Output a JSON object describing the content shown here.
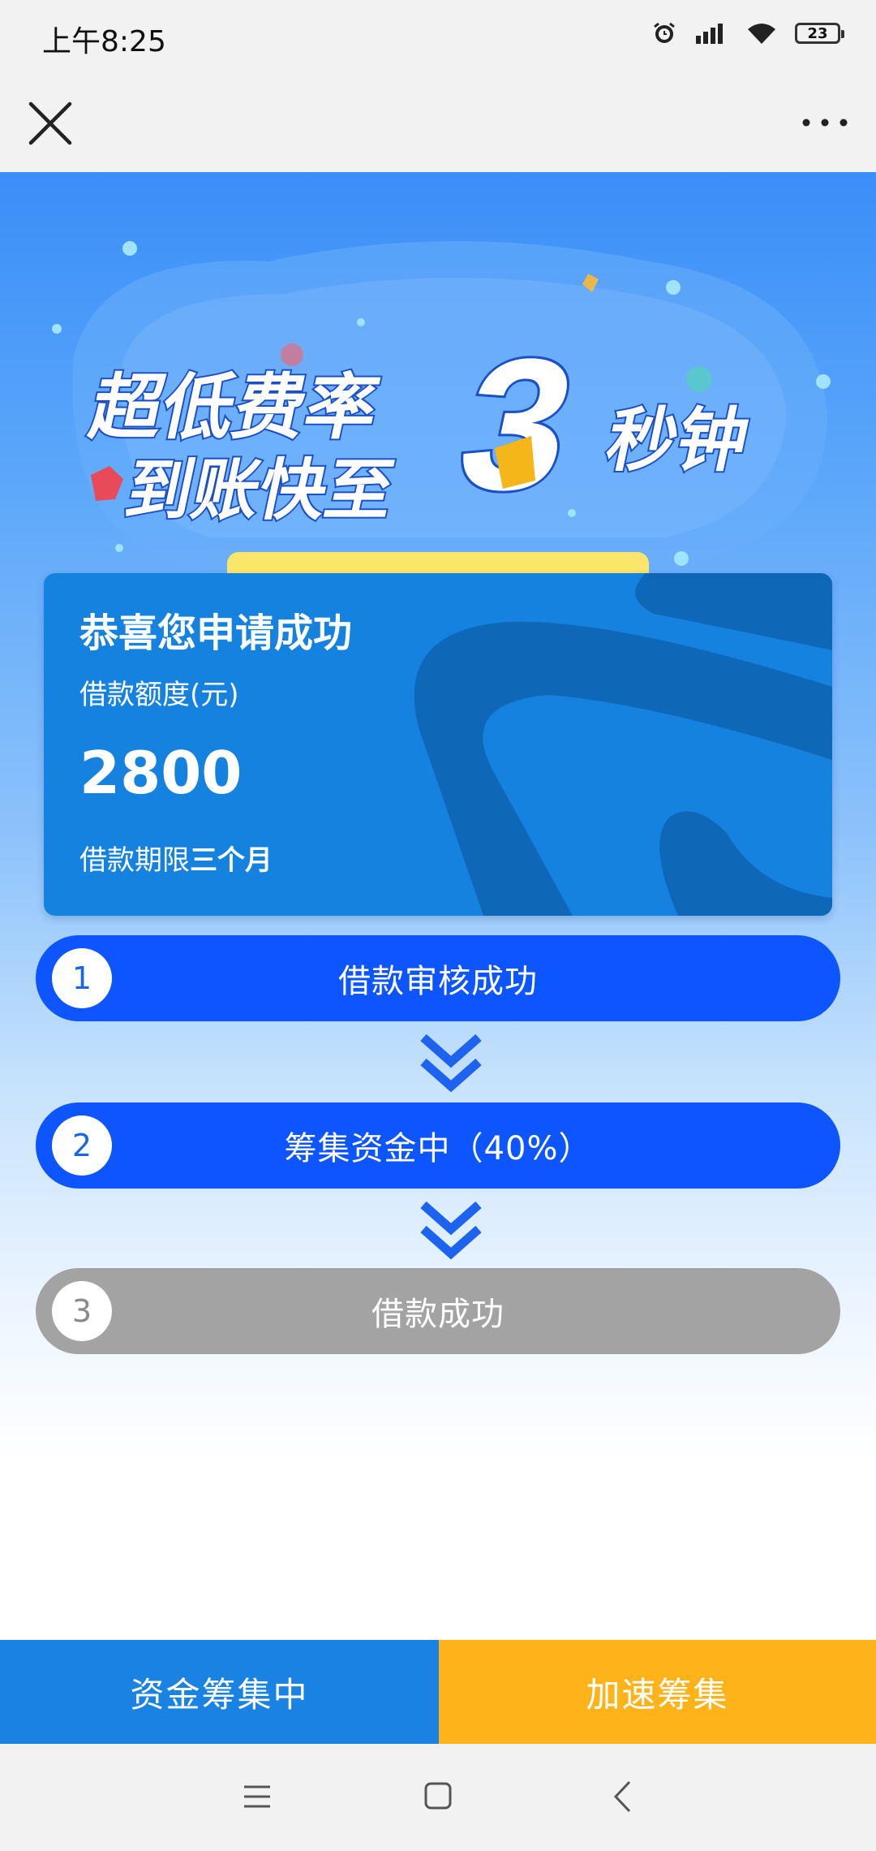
{
  "status": {
    "time": "上午8:25",
    "battery": "23"
  },
  "banner": {
    "line1": "超低费率",
    "line2": "到账快至",
    "big_number": "3",
    "line3": "秒钟"
  },
  "card": {
    "title": "恭喜您申请成功",
    "amount_label": "借款额度(元)",
    "amount": "2800",
    "term_prefix": "借款期限",
    "term_value": "三个月"
  },
  "steps": [
    {
      "num": "1",
      "label": "借款审核成功",
      "state": "done"
    },
    {
      "num": "2",
      "label": "筹集资金中（40%）",
      "state": "active"
    },
    {
      "num": "3",
      "label": "借款成功",
      "state": "pending"
    }
  ],
  "bottom": {
    "left_label": "资金筹集中",
    "right_label": "加速筹集"
  },
  "colors": {
    "step_blue": "#0c55ff",
    "step_grey": "#a3a3a3",
    "card_blue": "#1582e0",
    "button_blue": "#1a82e3",
    "button_orange": "#ffb31a"
  }
}
